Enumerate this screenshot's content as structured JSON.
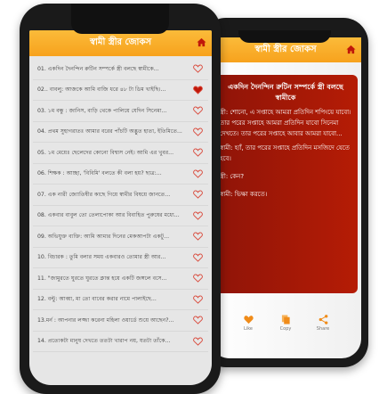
{
  "app": {
    "title": "স্বামী স্ত্রীর জোকস",
    "accent": "#f7a21d",
    "icon": "home-icon"
  },
  "list": {
    "items": [
      {
        "label": "01. একদিন দৈনন্দিন রুটিন সম্পর্কে স্ত্রী বলছে স্বামীকে...",
        "liked": false
      },
      {
        "label": "02.. বাবলু: আজকে আমি বাজি ধরে ৪৮ টা ডিম খাইছি।...",
        "liked": true
      },
      {
        "label": "03. ১ম বন্ধু : জানিস, বাড়ি থেকে পালিয়ে যেদিন সিনেমা...",
        "liked": false
      },
      {
        "label": "04. প্রথম সুহাগরাতঃ আমার বরের পাঁচটি অদ্ভুত হাতা, ইতিমিতে...",
        "liked": false
      },
      {
        "label": "05. ১ম মেয়েঃ ছেলেদের কোনো বিশ্বাস নেই। আমি এর খুবর...",
        "liked": false
      },
      {
        "label": "06. শিক্ষক : আচ্ছা, 'বিবিমি' বলতে কী বলা হয়? ছাত্র:...",
        "liked": false
      },
      {
        "label": "07. এক নারী জ্যোতিষীর কাছে গিয়ে স্বামীর বিষয়ে জানতে...",
        "liked": false
      },
      {
        "label": "08. একবার বাবুল তো তেলাপোকা আর বিবাহিত পুরুষের মধ্যে...",
        "liked": false
      },
      {
        "label": "09. অভিযুক্ত ব্যক্তি: আমি আমার দিনের মেকআপটা একটু...",
        "liked": false
      },
      {
        "label": "10. বিচারক : তুমি বলার সময় একবারও তোমার স্ত্রী আর...",
        "liked": false
      },
      {
        "label": "11. \"জামুরতে ঘুরতে ঘুরতে ক্লান্ত হয়ে একটি জঙ্গলে বসে...",
        "liked": false
      },
      {
        "label": "12. বল্টু: আব্বা, মা তো বাবের করার নামে পালাইছে...",
        "liked": false
      },
      {
        "label": "13.মর্ন : আপনার লজ্জা করেনা মহিলা ওয়ার্ডে শুয়ে আছেন?...",
        "liked": false
      },
      {
        "label": "14. প্রত্যেকটা মানুষ দেখতে ততটা খারাপ নয়, যতটা তাঁকে...",
        "liked": false
      }
    ]
  },
  "detail": {
    "heading": "একদিন দৈনন্দিন রুটিন সম্পর্কে স্ত্রী বলছে স্বামীকে",
    "paragraphs": [
      "স্ত্রী: শোনো, এ সপ্তাহে আমরা প্রতিদিন শপিংয়ে যাবো। তার পরের সপ্তাহে আমরা প্রতিদিন যাবো সিনেমা দেখতে। তার পরের সপ্তাহে আবার আমরা যাবো...",
      "স্বামী: হ্যাঁ, তার পরের সপ্তাহে প্রতিদিন মসজিদে যেতে হবে।",
      "স্ত্রী: কেন?",
      "স্বামী: ভিক্ষা করতে।"
    ],
    "card_color": "#a81806",
    "actions": {
      "like": "Like",
      "copy": "Copy",
      "share": "Share"
    }
  }
}
